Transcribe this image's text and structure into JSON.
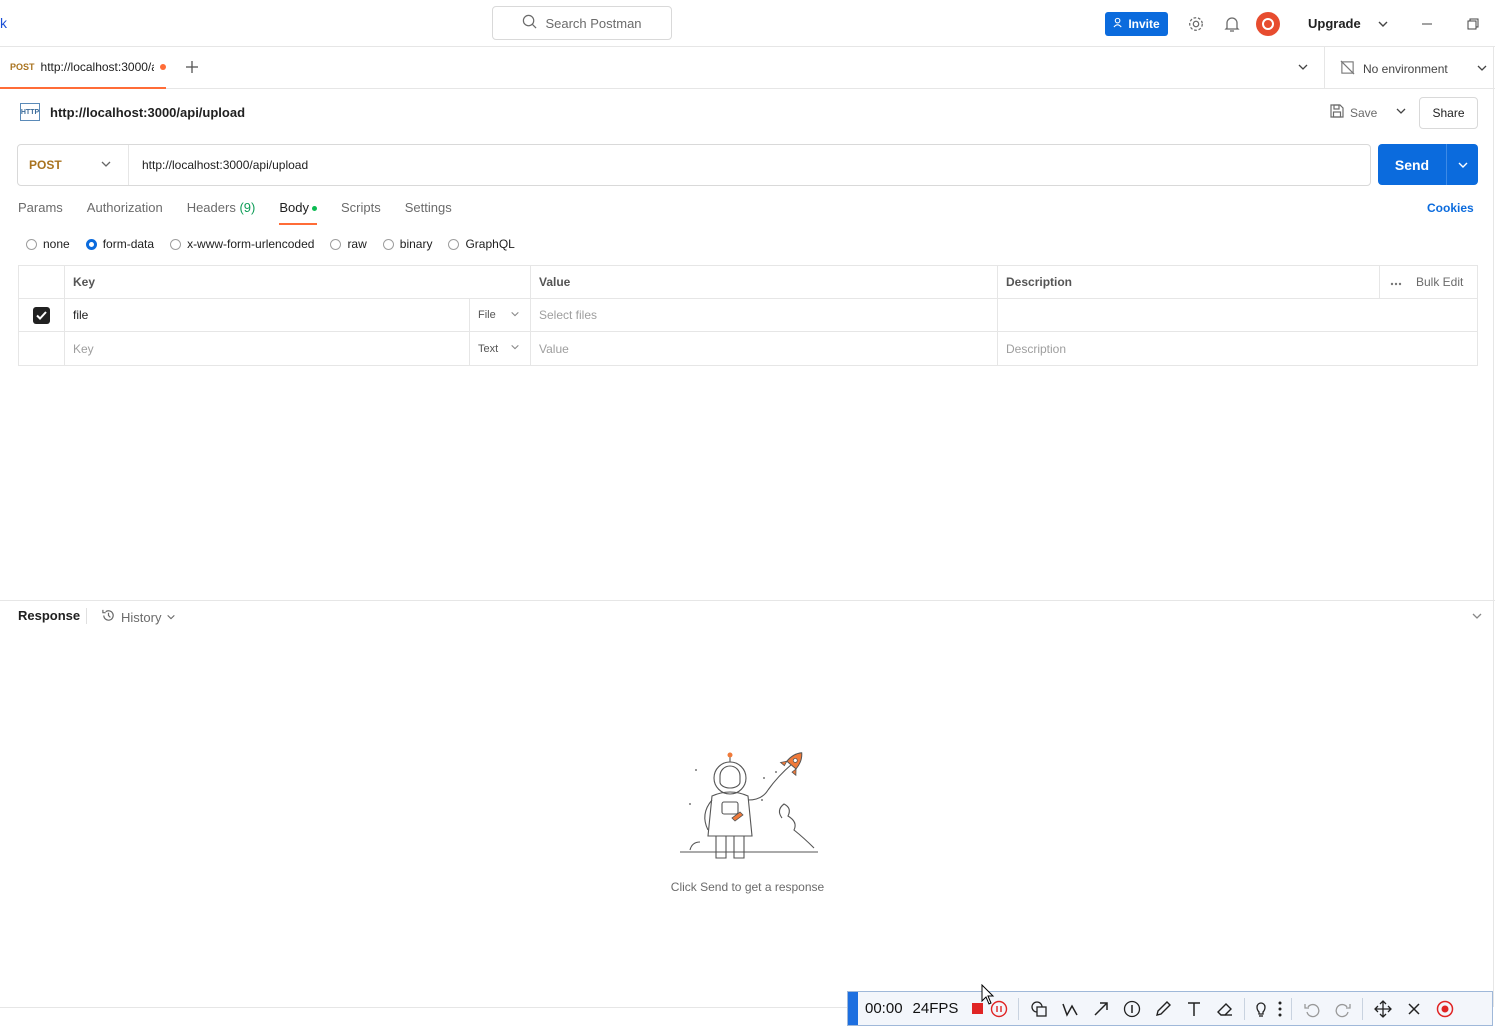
{
  "topbar": {
    "left_char": "k",
    "search_placeholder": "Search Postman",
    "invite_label": "Invite",
    "upgrade_label": "Upgrade"
  },
  "tabs": {
    "active_tab": {
      "method": "POST",
      "url": "http://localhost:3000/a"
    },
    "environment_label": "No environment"
  },
  "request": {
    "title": "http://localhost:3000/api/upload",
    "http_badge": "HTTP",
    "save_label": "Save",
    "share_label": "Share",
    "method": "POST",
    "url": "http://localhost:3000/api/upload",
    "send_label": "Send",
    "subtabs": {
      "params": "Params",
      "authorization": "Authorization",
      "headers": "Headers",
      "headers_count": "(9)",
      "body": "Body",
      "scripts": "Scripts",
      "settings": "Settings"
    },
    "cookies_label": "Cookies",
    "body_types": {
      "none": "none",
      "form_data": "form-data",
      "urlencoded": "x-www-form-urlencoded",
      "raw": "raw",
      "binary": "binary",
      "graphql": "GraphQL"
    },
    "selected_body_type": "form-data"
  },
  "form_table": {
    "headers": {
      "key": "Key",
      "value": "Value",
      "description": "Description",
      "bulk_edit": "Bulk Edit"
    },
    "rows": [
      {
        "key": "file",
        "type": "File",
        "value_placeholder": "Select files",
        "checked": true
      }
    ],
    "empty_row": {
      "key_placeholder": "Key",
      "type": "Text",
      "value_placeholder": "Value",
      "description_placeholder": "Description"
    }
  },
  "response": {
    "title": "Response",
    "history_label": "History",
    "empty_message": "Click Send to get a response"
  },
  "recorder": {
    "time": "00:00",
    "fps": "24FPS"
  },
  "colors": {
    "accent_orange": "#ff6c37",
    "primary_blue": "#0b6bdd",
    "method_post": "#a9731f",
    "active_dot": "#0cbb52"
  }
}
